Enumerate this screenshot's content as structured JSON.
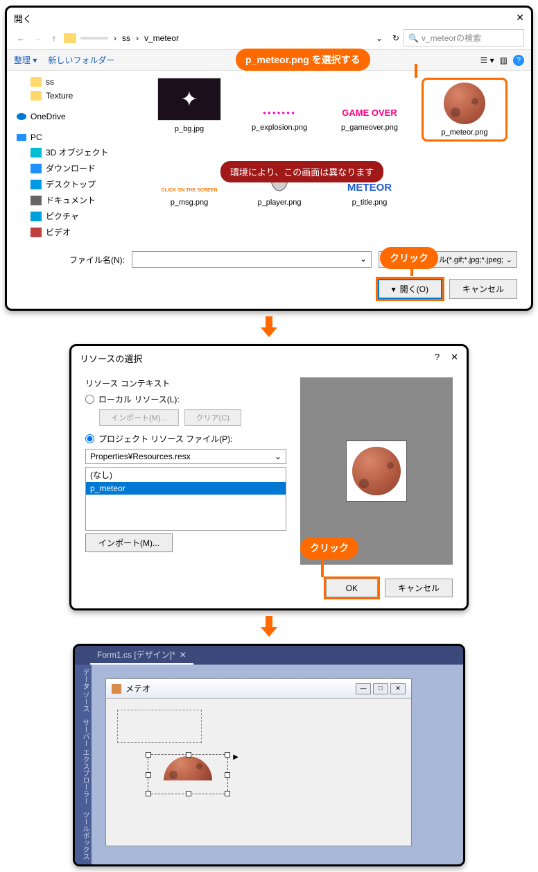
{
  "dialog1": {
    "title": "開く",
    "breadcrumb": {
      "folder": "ss",
      "sub": "v_meteor"
    },
    "search_placeholder": "v_meteorの検索",
    "organize": "整理 ▾",
    "newfolder": "新しいフォルダー",
    "tree": {
      "ss": "ss",
      "texture": "Texture",
      "onedrive": "OneDrive",
      "pc": "PC",
      "obj3d": "3D オブジェクト",
      "download": "ダウンロード",
      "desktop": "デスクトップ",
      "document": "ドキュメント",
      "picture": "ピクチャ",
      "video": "ビデオ"
    },
    "files": {
      "bg": "p_bg.jpg",
      "explosion": "p_explosion.png",
      "gameover": "p_gameover.png",
      "meteor": "p_meteor.png",
      "msg": "p_msg.png",
      "player": "p_player.png",
      "title": "p_title.png"
    },
    "thumbtext": {
      "gameover": "GAME OVER",
      "msg": "CLICK ON THE SCREEN",
      "title": "METEOR"
    },
    "filename_label": "ファイル名(N):",
    "filter": "イメージ ファイル(*.gif;*.jpg;*.jpeg;",
    "open_btn": "開く(O)",
    "cancel_btn": "キャンセル",
    "callout_select": "p_meteor.png  を選択する",
    "callout_click": "クリック",
    "env_note": "環境により、この画面は異なります"
  },
  "dialog2": {
    "title": "リソースの選択",
    "context_label": "リソース コンテキスト",
    "local": "ローカル リソース(L):",
    "import_btn": "インポート(M)...",
    "clear_btn": "クリア(C)",
    "project": "プロジェクト リソース ファイル(P):",
    "resx": "Properties¥Resources.resx",
    "list_none": "(なし)",
    "list_item": "p_meteor",
    "ok": "OK",
    "cancel": "キャンセル",
    "callout_click": "クリック"
  },
  "vs": {
    "tab": "Form1.cs [デザイン]*",
    "sidebar": "データ ソース　サーバー エクスプローラー　ツールボックス",
    "form_title": "メテオ"
  }
}
